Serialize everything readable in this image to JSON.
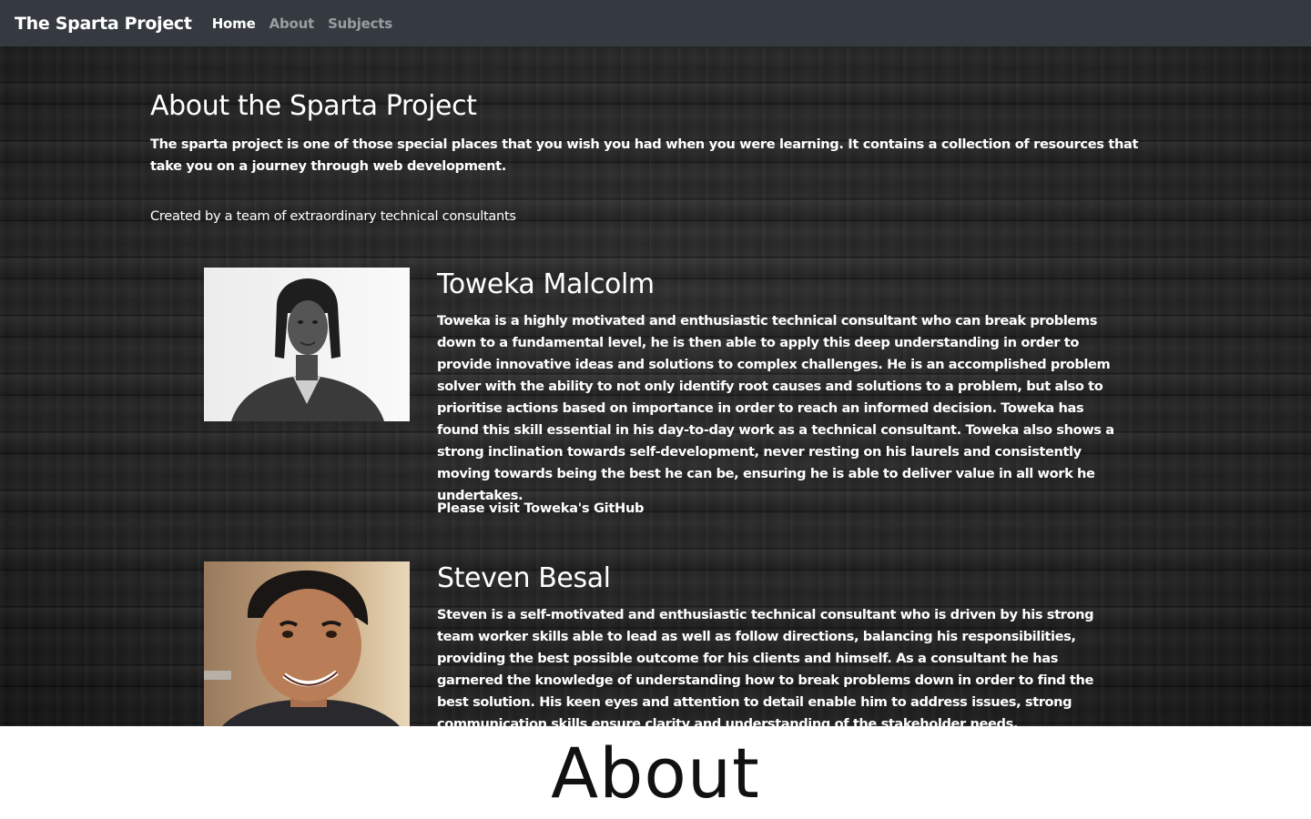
{
  "navbar": {
    "brand": "The Sparta Project",
    "links": [
      {
        "label": "Home",
        "active": true
      },
      {
        "label": "About",
        "active": false
      },
      {
        "label": "Subjects",
        "active": false
      }
    ]
  },
  "about": {
    "title": "About the Sparta Project",
    "intro": "The sparta project is one of those special places that you wish you had when you were learning. It contains a collection of resources that take you on a journey through web development.",
    "created_by": "Created by a team of extraordinary technical consultants"
  },
  "team": [
    {
      "name": "Toweka Malcolm",
      "bio": "Toweka is a highly motivated and enthusiastic technical consultant who can break problems down to a fundamental level, he is then able to apply this deep understanding in order to provide innovative ideas and solutions to complex challenges. He is an accomplished problem solver with the ability to not only identify root causes and solutions to a problem, but also to prioritise actions based on importance in order to reach an informed decision. Toweka has found this skill essential in his day-to-day work as a technical consultant. Toweka also shows a strong inclination towards self-development, never resting on his laurels and consistently moving towards being the best he can be, ensuring he is able to deliver value in all work he undertakes.",
      "github_link": "Please visit Toweka's GitHub"
    },
    {
      "name": "Steven Besal",
      "bio": "Steven is a self-motivated and enthusiastic technical consultant who is driven by his strong team worker skills able to lead as well as follow directions, balancing his responsibilities, providing the best possible outcome for his clients and himself. As a consultant he has garnered the knowledge of understanding how to break problems down in order to find the best solution. His keen eyes and attention to detail enable him to address issues, strong communication skills ensure clarity and understanding of the stakeholder needs."
    }
  ],
  "caption": "About"
}
